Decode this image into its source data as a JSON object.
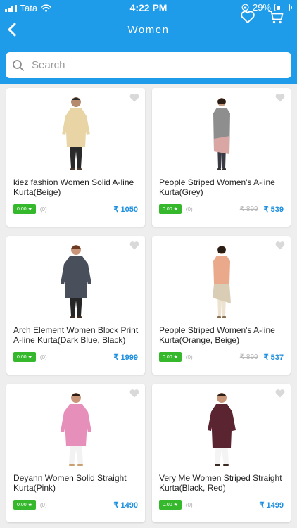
{
  "status_bar": {
    "carrier": "Tata",
    "time": "4:22 PM",
    "battery": "29%",
    "battery_level": 0.29
  },
  "header": {
    "title": "Women"
  },
  "search": {
    "placeholder": "Search"
  },
  "colors": {
    "header": "#1e9be9",
    "rating": "#35b82b",
    "price": "#1e8fdf"
  },
  "products": [
    {
      "name": "kiez fashion Women Solid A-line Kurta(Beige)",
      "rating": "0.00 ★",
      "count": "(0)",
      "mrp": "",
      "price": "₹ 1050",
      "kurta": "#e8d4a4",
      "pants": "#2a2a2a"
    },
    {
      "name": "People Striped Women's A-line Kurta(Grey)",
      "rating": "0.00 ★",
      "count": "(0)",
      "mrp": "₹ 899",
      "price": "₹ 539",
      "kurta": "#8e8e8e",
      "pants": "#3a3a44"
    },
    {
      "name": "Arch Element Women Block Print A-line Kurta(Dark Blue, Black)",
      "rating": "0.00 ★",
      "count": "(0)",
      "mrp": "",
      "price": "₹ 1999",
      "kurta": "#4a4f5c",
      "pants": "#262626"
    },
    {
      "name": "People Striped Women's A-line Kurta(Orange, Beige)",
      "rating": "0.00 ★",
      "count": "(0)",
      "mrp": "₹ 899",
      "price": "₹ 537",
      "kurta": "#e9a98a",
      "pants": "#ece2cf"
    },
    {
      "name": "Deyann Women Solid Straight Kurta(Pink)",
      "rating": "0.00 ★",
      "count": "(0)",
      "mrp": "",
      "price": "₹ 1490",
      "kurta": "#e78fbb",
      "pants": "#f2f2f2"
    },
    {
      "name": "Very Me Women Striped Straight Kurta(Black, Red)",
      "rating": "0.00 ★",
      "count": "(0)",
      "mrp": "",
      "price": "₹ 1499",
      "kurta": "#5a2430",
      "pants": "#f4f4f4"
    }
  ]
}
